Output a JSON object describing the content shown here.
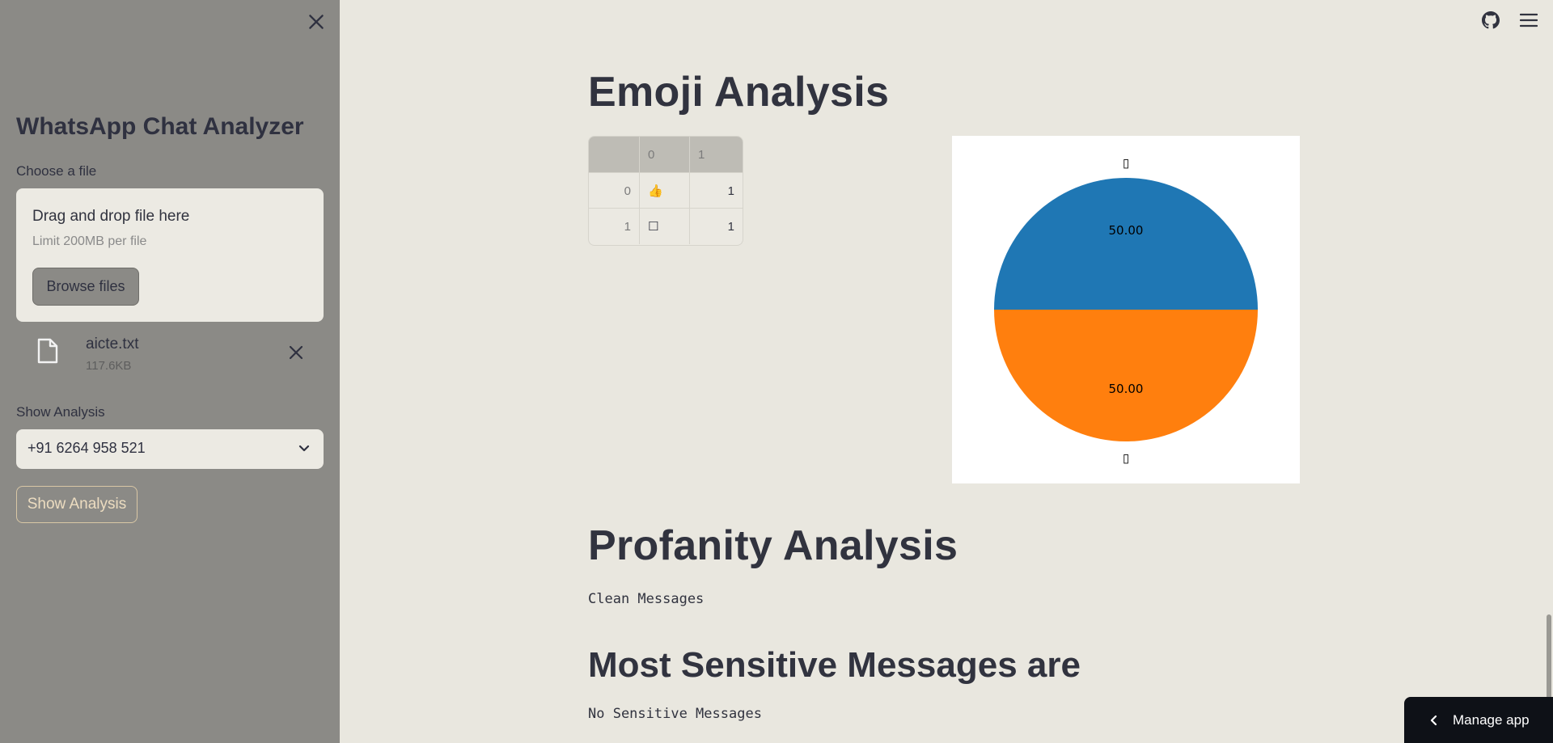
{
  "sidebar": {
    "title": "WhatsApp Chat Analyzer",
    "file_label": "Choose a file",
    "dropzone_text": "Drag and drop file here",
    "dropzone_limit": "Limit 200MB per file",
    "browse_label": "Browse files",
    "file_name": "aicte.txt",
    "file_size": "117.6KB",
    "analysis_label": "Show Analysis",
    "selected_user": "+91 6264 958 521",
    "show_button_label": "Show Analysis"
  },
  "main": {
    "emoji_heading": "Emoji Analysis",
    "table": {
      "columns": [
        "",
        "0",
        "1"
      ],
      "rows": [
        {
          "index": "0",
          "emoji": "👍",
          "count": "1"
        },
        {
          "index": "1",
          "emoji": "☐",
          "count": "1"
        }
      ]
    },
    "profanity_heading": "Profanity Analysis",
    "profanity_result": "Clean Messages",
    "sensitive_heading": "Most Sensitive Messages are",
    "sensitive_result": "No Sensitive Messages"
  },
  "chart_data": {
    "type": "pie",
    "labels": [
      "▯",
      "▯"
    ],
    "values": [
      50.0,
      50.0
    ],
    "value_labels": [
      "50.00",
      "50.00"
    ],
    "colors": [
      "#1f77b4",
      "#ff7f0e"
    ]
  },
  "footer": {
    "manage_label": "Manage app"
  },
  "icons": [
    "close-icon",
    "file-icon",
    "chevron-down-icon",
    "github-icon",
    "menu-icon",
    "chevron-left-icon"
  ]
}
